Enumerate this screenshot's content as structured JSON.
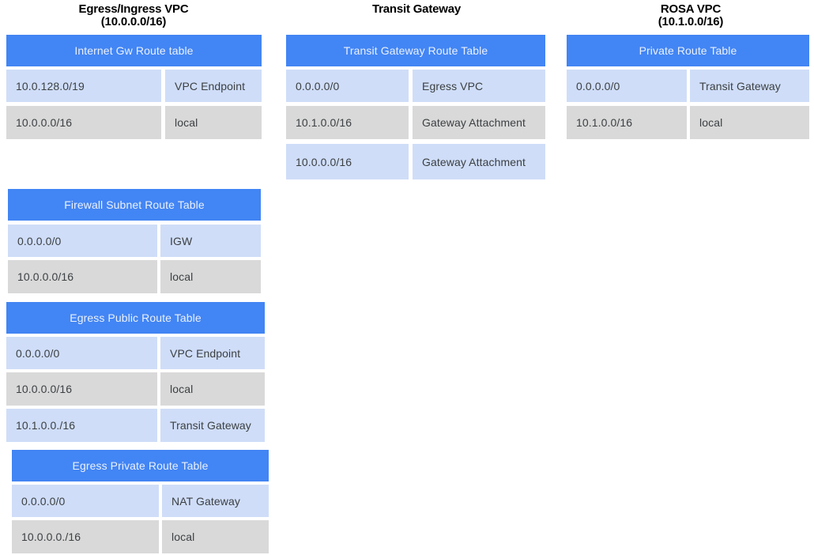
{
  "groups": [
    {
      "id": "egress-ingress-vpc",
      "title_line1": "Egress/Ingress VPC",
      "title_line2": "(10.0.0.0/16)",
      "tables": [
        {
          "id": "internet-gw-route-table",
          "header": "Internet Gw Route table",
          "rows": [
            {
              "destination": "10.0.128.0/19",
              "target": "VPC Endpoint",
              "style": "blue"
            },
            {
              "destination": "10.0.0.0/16",
              "target": "local",
              "style": "gray"
            }
          ]
        },
        {
          "id": "firewall-subnet-route-table",
          "header": "Firewall Subnet Route Table",
          "rows": [
            {
              "destination": "0.0.0.0/0",
              "target": "IGW",
              "style": "blue"
            },
            {
              "destination": "10.0.0.0/16",
              "target": "local",
              "style": "gray"
            }
          ]
        },
        {
          "id": "egress-public-route-table",
          "header": "Egress Public Route Table",
          "rows": [
            {
              "destination": "0.0.0.0/0",
              "target": "VPC Endpoint",
              "style": "blue"
            },
            {
              "destination": "10.0.0.0/16",
              "target": "local",
              "style": "gray"
            },
            {
              "destination": "10.1.0.0./16",
              "target": "Transit Gateway",
              "style": "blue"
            }
          ]
        },
        {
          "id": "egress-private-route-table",
          "header": "Egress Private Route Table",
          "rows": [
            {
              "destination": "0.0.0.0/0",
              "target": "NAT Gateway",
              "style": "blue"
            },
            {
              "destination": "10.0.0.0./16",
              "target": "local",
              "style": "gray"
            }
          ]
        }
      ]
    },
    {
      "id": "transit-gateway",
      "title_line1": "Transit Gateway",
      "title_line2": "",
      "tables": [
        {
          "id": "transit-gateway-route-table",
          "header": "Transit Gateway Route Table",
          "rows": [
            {
              "destination": "0.0.0.0/0",
              "target": "Egress VPC",
              "style": "blue"
            },
            {
              "destination": "10.1.0.0/16",
              "target": "Gateway Attachment",
              "style": "gray"
            },
            {
              "destination": "10.0.0.0/16",
              "target": "Gateway Attachment",
              "style": "blue"
            }
          ]
        }
      ]
    },
    {
      "id": "rosa-vpc",
      "title_line1": "ROSA VPC",
      "title_line2": "(10.1.0.0/16)",
      "tables": [
        {
          "id": "private-route-table",
          "header": "Private Route Table",
          "rows": [
            {
              "destination": "0.0.0.0/0",
              "target": "Transit Gateway",
              "style": "blue"
            },
            {
              "destination": "10.1.0.0/16",
              "target": "local",
              "style": "gray"
            }
          ]
        }
      ]
    }
  ],
  "colors": {
    "header_blue": "#4285F4",
    "row_blue": "#CFDDF8",
    "row_gray": "#D9D9D9",
    "header_text": "#EAF0FC",
    "cell_text": "#3c4043",
    "title_text": "#000000",
    "background": "#FFFFFF"
  }
}
